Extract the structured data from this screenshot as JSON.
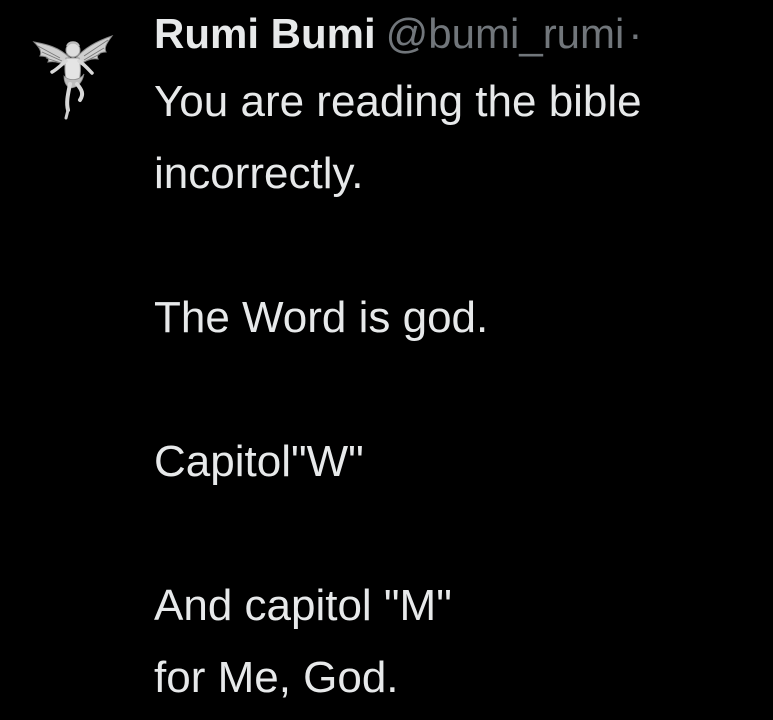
{
  "author": {
    "display_name": "Rumi Bumi",
    "handle": "@bumi_rumi",
    "separator": "·",
    "avatar_icon": "cherub-angel-icon"
  },
  "tweet": {
    "lines": [
      "You are reading the bible",
      "incorrectly.",
      "",
      "The Word is god.",
      "",
      "Capitol\"W\"",
      "",
      "And capitol \"M\"",
      "for Me, God."
    ]
  },
  "colors": {
    "background": "#000000",
    "text_primary": "#e7e9ea",
    "text_secondary": "#71767b"
  }
}
